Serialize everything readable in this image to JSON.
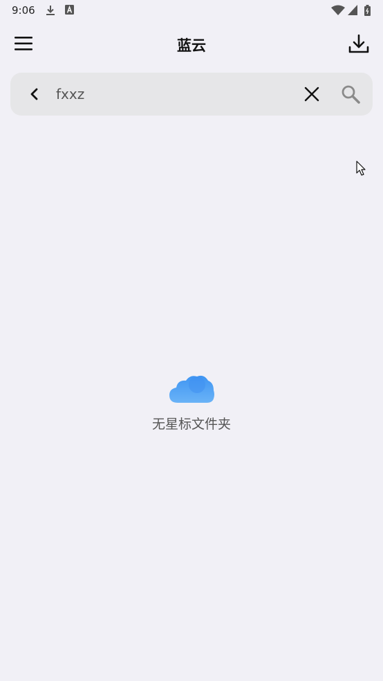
{
  "status_bar": {
    "time": "9:06",
    "icons": [
      "download-icon",
      "text-a-icon",
      "wifi-icon",
      "signal-icon",
      "battery-icon"
    ]
  },
  "app_bar": {
    "title": "蓝云",
    "left_icon": "menu-icon",
    "right_icon": "download-icon"
  },
  "search": {
    "value": "fxxz",
    "back_icon": "chevron-left-icon",
    "clear_icon": "close-icon",
    "search_icon": "search-icon"
  },
  "empty_state": {
    "icon": "cloud-icon",
    "message": "无星标文件夹"
  },
  "colors": {
    "background": "#f1f0f6",
    "search_bar": "#e6e6e8",
    "cloud": "#4d9ef4"
  }
}
